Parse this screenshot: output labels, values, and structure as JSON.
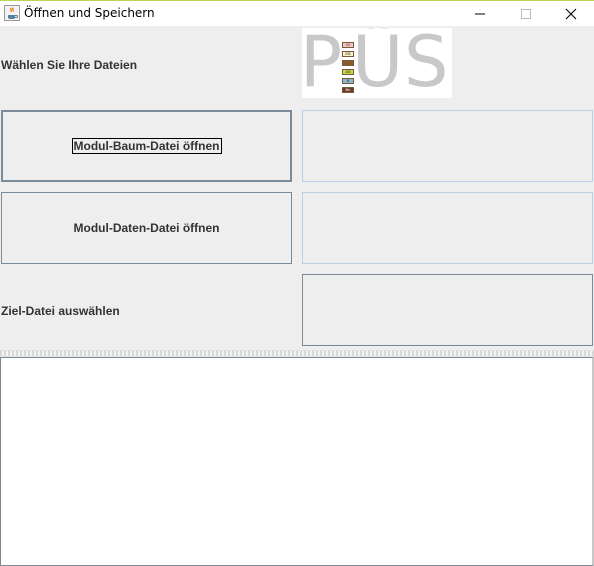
{
  "window": {
    "title": "Öffnen und Speichern",
    "icon": "java-coffee-cup-icon",
    "controls": [
      "minimize-icon",
      "maximize-icon",
      "close-icon"
    ]
  },
  "header": {
    "prompt_label": "Wählen Sie Ihre Dateien",
    "logo_text": "PÜS",
    "logo_chip_labels": [
      "M",
      "EB",
      "",
      "AB",
      "B",
      "Be"
    ]
  },
  "buttons": {
    "open_tree": "Modul-Baum-Datei öffnen",
    "open_data": "Modul-Daten-Datei öffnen"
  },
  "target": {
    "label": "Ziel-Datei auswählen"
  },
  "output": {
    "value": ""
  },
  "colors": {
    "window_bg": "#eeeeee",
    "button_border": "#7a8a99",
    "panel_border": "#b8cfe5",
    "text": "#333333",
    "logo_text": "#c8c8c8"
  }
}
